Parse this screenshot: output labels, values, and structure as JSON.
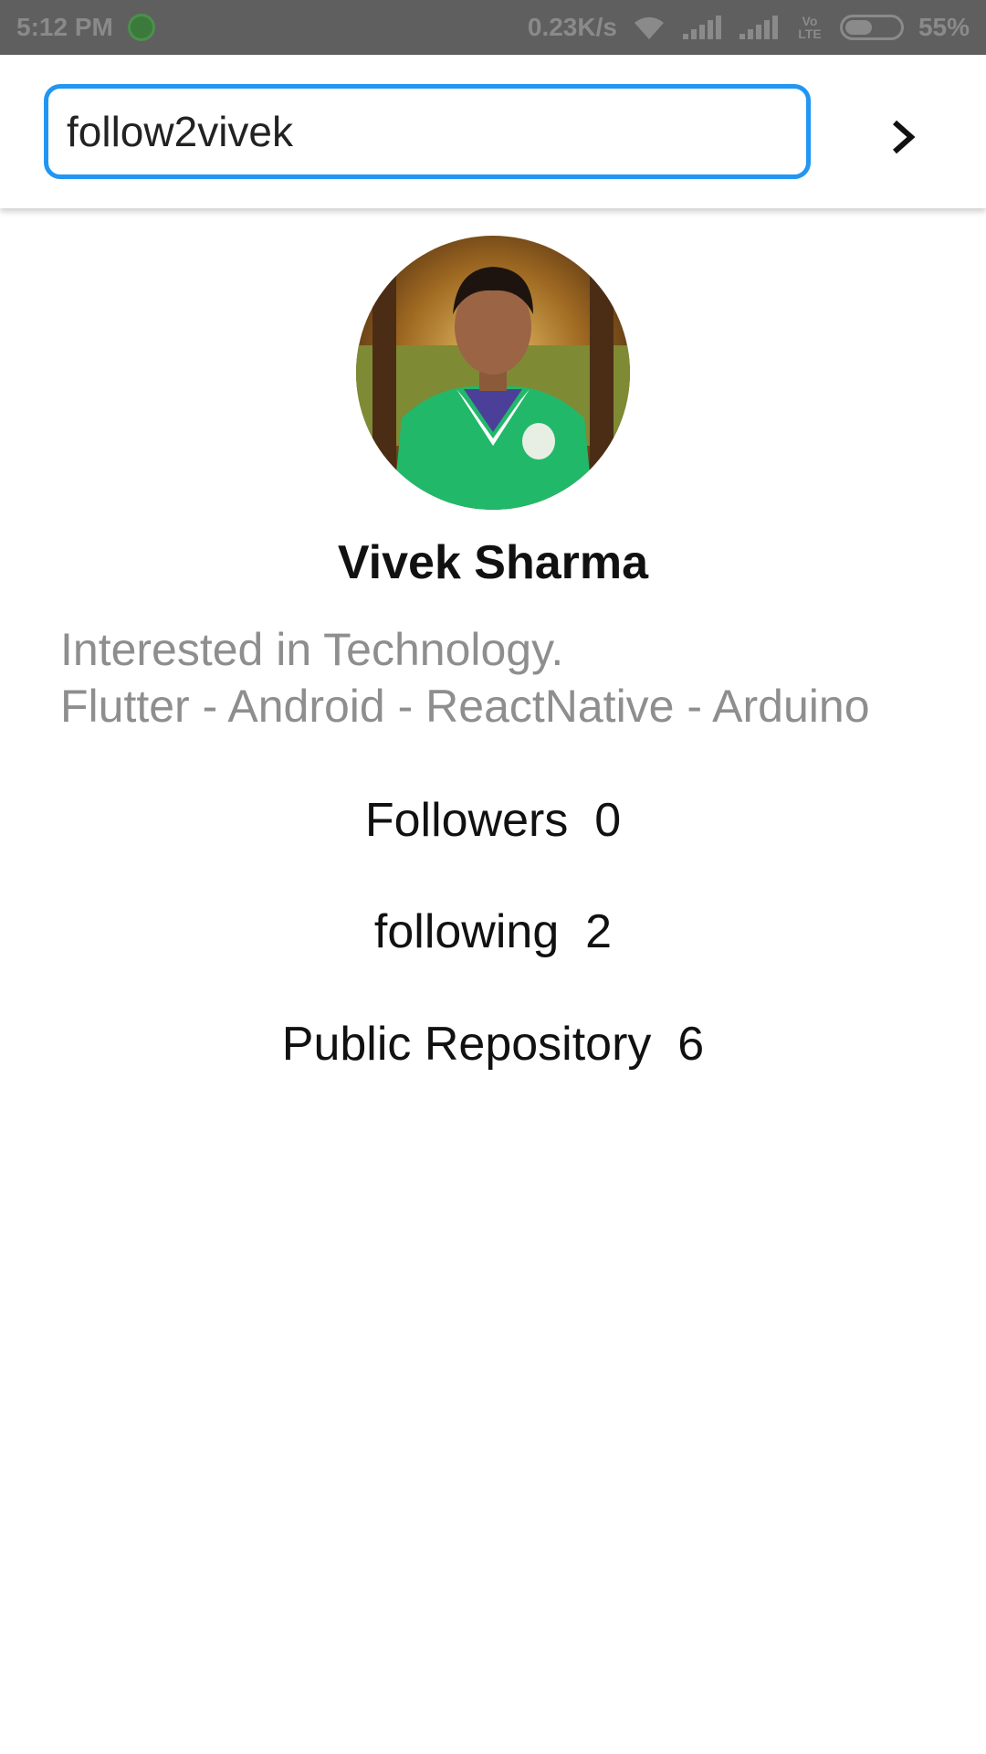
{
  "status_bar": {
    "time": "5:12 PM",
    "network_speed": "0.23K/s",
    "volte_label": "Vo LTE",
    "battery_percent_text": "55%",
    "battery_level": 0.55,
    "icons": [
      "whatsapp-icon",
      "wifi-icon",
      "signal-icon",
      "signal-icon",
      "volte-icon",
      "battery-icon"
    ]
  },
  "search": {
    "value": "follow2vivek",
    "border_color": "#2196f3",
    "submit_icon": "chevron-right-icon"
  },
  "profile": {
    "name": "Vivek Sharma",
    "bio_lines": [
      "Interested in Technology.",
      "Flutter - Android - ReactNative - Arduino"
    ],
    "stats": {
      "followers": {
        "label": "Followers",
        "value": "0"
      },
      "following": {
        "label": "following",
        "value": "2"
      },
      "repos": {
        "label": "Public Repository",
        "value": "6"
      }
    }
  },
  "colors": {
    "status_bar_bg": "#5f5f5f",
    "accent": "#2196f3",
    "bio_text": "#8e8e8e",
    "primary_text": "#111111"
  }
}
